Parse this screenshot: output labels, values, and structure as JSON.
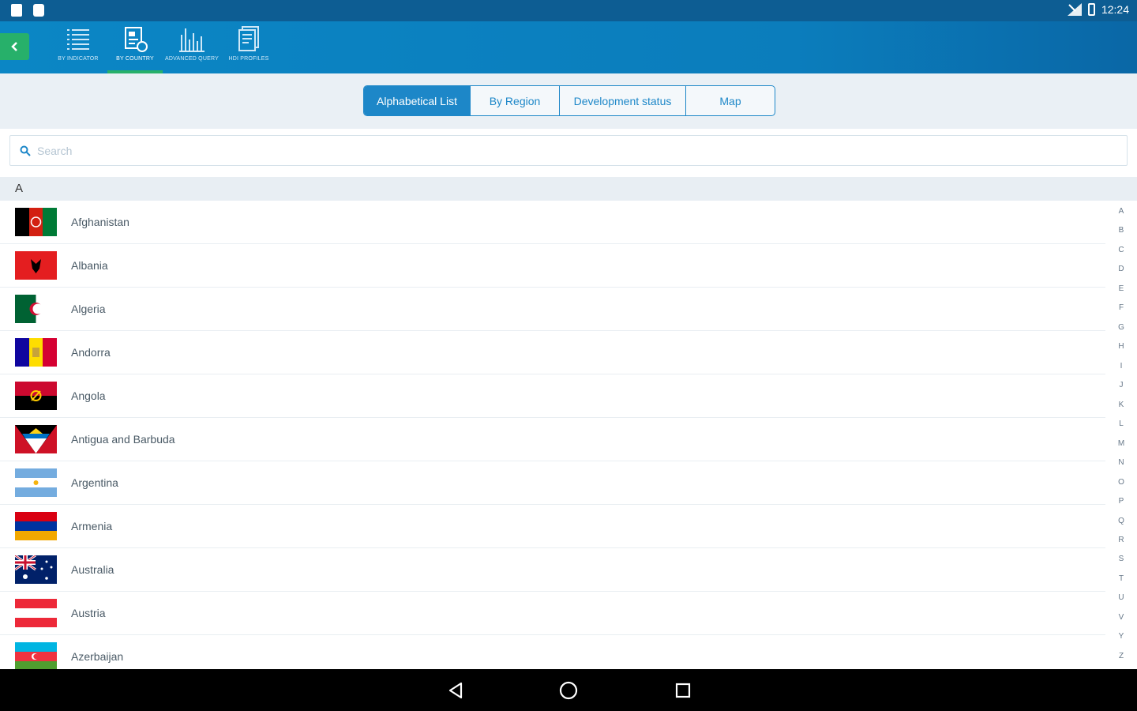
{
  "status_bar": {
    "time": "12:24"
  },
  "app_bar": {
    "tabs": [
      {
        "label": "BY INDICATOR",
        "icon": "list-icon"
      },
      {
        "label": "BY COUNTRY",
        "icon": "country-doc-icon"
      },
      {
        "label": "ADVANCED QUERY",
        "icon": "bar-chart-icon"
      },
      {
        "label": "HDI PROFILES",
        "icon": "profile-doc-icon"
      }
    ],
    "active_tab": "BY COUNTRY"
  },
  "view_tabs": {
    "items": [
      {
        "label": "Alphabetical List"
      },
      {
        "label": "By Region"
      },
      {
        "label": "Development status"
      },
      {
        "label": "Map"
      }
    ],
    "active": "Alphabetical List"
  },
  "search": {
    "placeholder": "Search"
  },
  "section": {
    "letter": "A"
  },
  "countries": [
    {
      "name": "Afghanistan",
      "flag": "af"
    },
    {
      "name": "Albania",
      "flag": "al"
    },
    {
      "name": "Algeria",
      "flag": "dz"
    },
    {
      "name": "Andorra",
      "flag": "ad"
    },
    {
      "name": "Angola",
      "flag": "ao"
    },
    {
      "name": "Antigua and Barbuda",
      "flag": "ag"
    },
    {
      "name": "Argentina",
      "flag": "ar"
    },
    {
      "name": "Armenia",
      "flag": "am"
    },
    {
      "name": "Australia",
      "flag": "au"
    },
    {
      "name": "Austria",
      "flag": "at"
    },
    {
      "name": "Azerbaijan",
      "flag": "az"
    }
  ],
  "alpha_index": [
    "A",
    "B",
    "C",
    "D",
    "E",
    "F",
    "G",
    "H",
    "I",
    "J",
    "K",
    "L",
    "M",
    "N",
    "O",
    "P",
    "Q",
    "R",
    "S",
    "T",
    "U",
    "V",
    "Y",
    "Z"
  ],
  "colors": {
    "primary": "#0b86c5",
    "accent_green": "#27b06a",
    "segment_blue": "#1d87c8"
  }
}
